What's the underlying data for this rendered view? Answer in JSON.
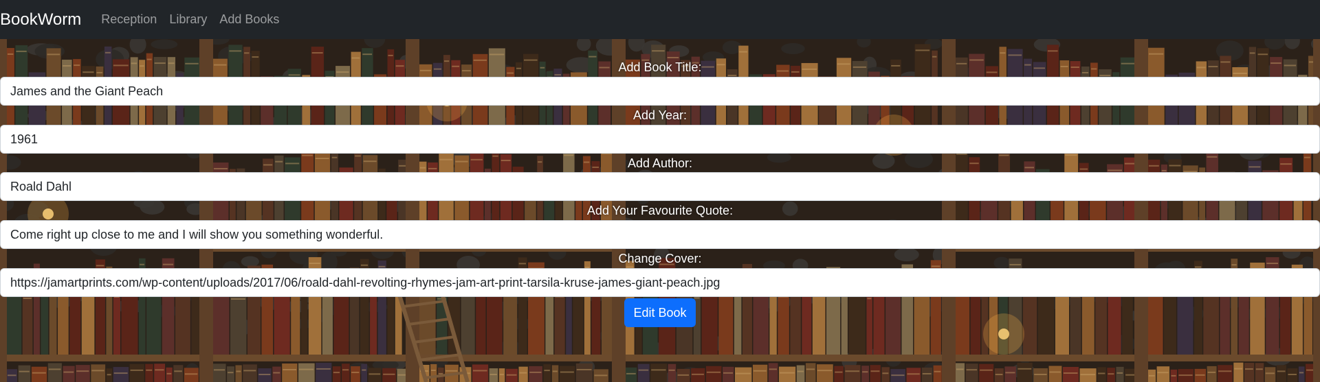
{
  "navbar": {
    "brand": "BookWorm",
    "links": [
      "Reception",
      "Library",
      "Add Books"
    ]
  },
  "form": {
    "fields": [
      {
        "label": "Add Book Title:",
        "value": "James and the Giant Peach"
      },
      {
        "label": "Add Year:",
        "value": "1961"
      },
      {
        "label": "Add Author:",
        "value": "Roald Dahl"
      },
      {
        "label": "Add Your Favourite Quote:",
        "value": "Come right up close to me and I will show you something wonderful."
      },
      {
        "label": "Change Cover:",
        "value": "https://jamartprints.com/wp-content/uploads/2017/06/roald-dahl-revolting-rhymes-jam-art-print-tarsila-kruse-james-giant-peach.jpg"
      }
    ],
    "submit_label": "Edit Book"
  },
  "colors": {
    "navbar_bg": "#212529",
    "primary_button": "#0d6efd",
    "label_text": "#ffffff"
  }
}
